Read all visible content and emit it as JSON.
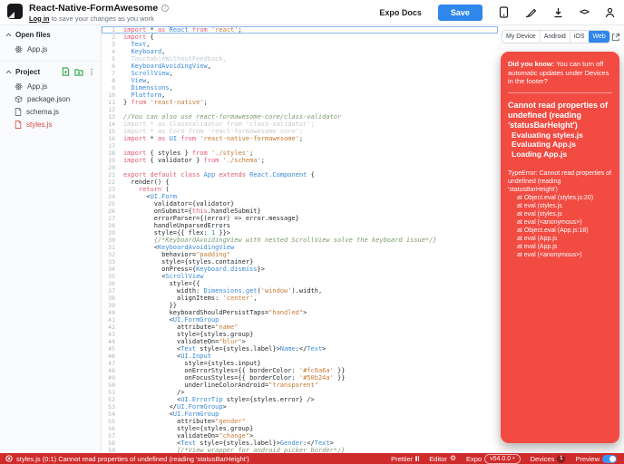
{
  "header": {
    "title": "React-Native-FormAwesome",
    "login_link": "Log in",
    "login_hint": " to save your changes as you work",
    "expo_docs": "Expo Docs",
    "save_label": "Save"
  },
  "sidebar": {
    "open_files_header": "Open files",
    "open_files": [
      {
        "label": "App.js",
        "icon": "react"
      }
    ],
    "project_header": "Project",
    "project_files": [
      {
        "label": "App.js",
        "icon": "react"
      },
      {
        "label": "package.json",
        "icon": "package"
      },
      {
        "label": "schema.js",
        "icon": "file"
      },
      {
        "label": "styles.js",
        "icon": "file",
        "error": true
      }
    ]
  },
  "editor": {
    "lines": [
      {
        "t": "import * as React from 'react';",
        "active": true
      },
      {
        "t": "import {"
      },
      {
        "t": "  Text,"
      },
      {
        "t": "  Keyboard,"
      },
      {
        "t": "  TouchableWithoutFeedback,",
        "dim": true
      },
      {
        "t": "  KeyboardAvoidingView,"
      },
      {
        "t": "  ScrollView,"
      },
      {
        "t": "  View,"
      },
      {
        "t": "  Dimensions,"
      },
      {
        "t": "  Platform,"
      },
      {
        "t": "} from 'react-native';"
      },
      {
        "t": ""
      },
      {
        "t": "//You can also use react-formawesome-core/class-validator"
      },
      {
        "t": "import * as ClassValidator from 'class-validator';",
        "dim": true
      },
      {
        "t": "import * as Core from 'react-formawesome-core';",
        "dim": true
      },
      {
        "t": "import * as UI from 'react-native-formawesome';"
      },
      {
        "t": ""
      },
      {
        "t": "import { styles } from './styles';"
      },
      {
        "t": "import { validator } from './schema';"
      },
      {
        "t": ""
      },
      {
        "t": "export default class App extends React.Component {"
      },
      {
        "t": "  render() {"
      },
      {
        "t": "    return ("
      },
      {
        "t": "      <UI.Form"
      },
      {
        "t": "        validator={validator}"
      },
      {
        "t": "        onSubmit={this.handleSubmit}"
      },
      {
        "t": "        errorParser={(error) => error.message}"
      },
      {
        "t": "        handleUnparsedErrors"
      },
      {
        "t": "        style={{ flex: 1 }}>"
      },
      {
        "t": "        {/*KeyboardAvoidingView with nested ScrollView solve the keyboard issue*/}"
      },
      {
        "t": "        <KeyboardAvoidingView"
      },
      {
        "t": "          behavior=\"padding\""
      },
      {
        "t": "          style={styles.container}"
      },
      {
        "t": "          onPress={Keyboard.dismiss}>"
      },
      {
        "t": "          <ScrollView"
      },
      {
        "t": "            style={{"
      },
      {
        "t": "              width: Dimensions.get('window').width,"
      },
      {
        "t": "              alignItems: 'center',"
      },
      {
        "t": "            }}"
      },
      {
        "t": "            keyboardShouldPersistTaps=\"handled\">"
      },
      {
        "t": "            <UI.FormGroup"
      },
      {
        "t": "              attribute=\"name\""
      },
      {
        "t": "              style={styles.group}"
      },
      {
        "t": "              validateOn=\"blur\">"
      },
      {
        "t": "              <Text style={styles.label}>Name:</Text>"
      },
      {
        "t": "              <UI.Input"
      },
      {
        "t": "                style={styles.input}"
      },
      {
        "t": "                onErrorStyles={{ borderColor: '#fc6a6a' }}"
      },
      {
        "t": "                onFocusStyles={{ borderColor: '#50b24a' }}"
      },
      {
        "t": "                underlineColorAndroid=\"transparent\""
      },
      {
        "t": "              />"
      },
      {
        "t": "              <UI.ErrorTip style={styles.error} />"
      },
      {
        "t": "            </UI.FormGroup>"
      },
      {
        "t": "            <UI.FormGroup"
      },
      {
        "t": "              attribute=\"gender\""
      },
      {
        "t": "              style={styles.group}"
      },
      {
        "t": "              validateOn=\"change\">"
      },
      {
        "t": "              <Text style={styles.label}>Gender:</Text>"
      },
      {
        "t": "              {/*View wrapper for android picker border*/}"
      }
    ]
  },
  "preview": {
    "tabs": [
      "My Device",
      "Android",
      "iOS",
      "Web"
    ],
    "active_tab": "Web",
    "tip_bold": "Did you know:",
    "tip_rest": " You can turn off automatic updates under Devices in the footer?",
    "error_title": "Cannot read properties of undefined (reading 'statusBarHeight')",
    "error_lines": [
      "Evaluating styles.js",
      "Evaluating App.js",
      "Loading App.js"
    ],
    "stack": [
      "TypeError: Cannot read properties of undefined (reading 'statusBarHeight')",
      "at Object.eval (styles.js:20)",
      "at eval (styles.js",
      "at eval (styles.js",
      "at eval (<anonymous>)",
      "at Object.eval (App.js:18)",
      "at eval (App.js",
      "at eval (App.js",
      "at eval (<anonymous>)"
    ]
  },
  "statusbar": {
    "error_text": "styles.js (0:1) Cannot read properties of undefined (reading 'statusBarHeight')",
    "prettier_label": "Prettier",
    "editor_label": "Editor",
    "expo_label": "Expo",
    "version": "v54.0.0",
    "devices_label": "Devices",
    "devices_count": "1",
    "preview_label": "Preview"
  },
  "colors": {
    "accent_blue": "#2f86eb",
    "error_card": "#f14b42",
    "statusbar_red": "#d02b2b",
    "file_error_red": "#d84a44",
    "action_green": "#28a745"
  }
}
